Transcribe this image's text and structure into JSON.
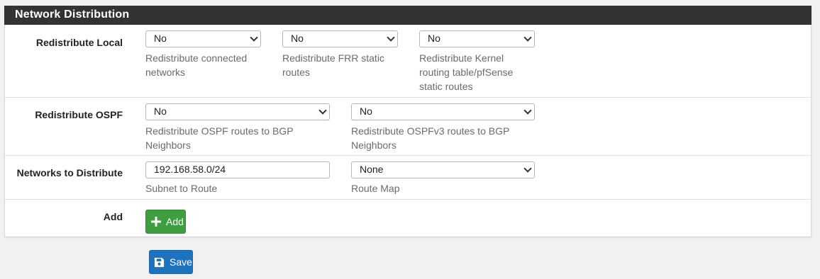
{
  "panel": {
    "title": "Network Distribution"
  },
  "redistribute_local": {
    "label": "Redistribute Local",
    "fields": [
      {
        "value": "No",
        "help_line1": "Redistribute connected",
        "help_line2": "networks",
        "help_line3": ""
      },
      {
        "value": "No",
        "help_line1": "Redistribute FRR static",
        "help_line2": "routes",
        "help_line3": ""
      },
      {
        "value": "No",
        "help_line1": "Redistribute Kernel",
        "help_line2": "routing table/pfSense",
        "help_line3": "static routes"
      }
    ]
  },
  "redistribute_ospf": {
    "label": "Redistribute OSPF",
    "fields": [
      {
        "value": "No",
        "help_line1": "Redistribute OSPF routes to BGP",
        "help_line2": "Neighbors"
      },
      {
        "value": "No",
        "help_line1": "Redistribute OSPFv3 routes to BGP",
        "help_line2": "Neighbors"
      }
    ]
  },
  "networks_to_distribute": {
    "label": "Networks to Distribute",
    "subnet_value": "192.168.58.0/24",
    "subnet_help": "Subnet to Route",
    "route_map_value": "None",
    "route_map_help": "Route Map"
  },
  "add_row": {
    "label": "Add",
    "button_label": "Add"
  },
  "save_button": {
    "label": "Save"
  },
  "icons": {
    "add": "plus-icon",
    "save": "floppy-disk-icon",
    "select": "chevron-down-icon"
  },
  "colors": {
    "header_bg": "#333333",
    "add_green": "#3f9e3f",
    "save_blue": "#1e73be"
  }
}
